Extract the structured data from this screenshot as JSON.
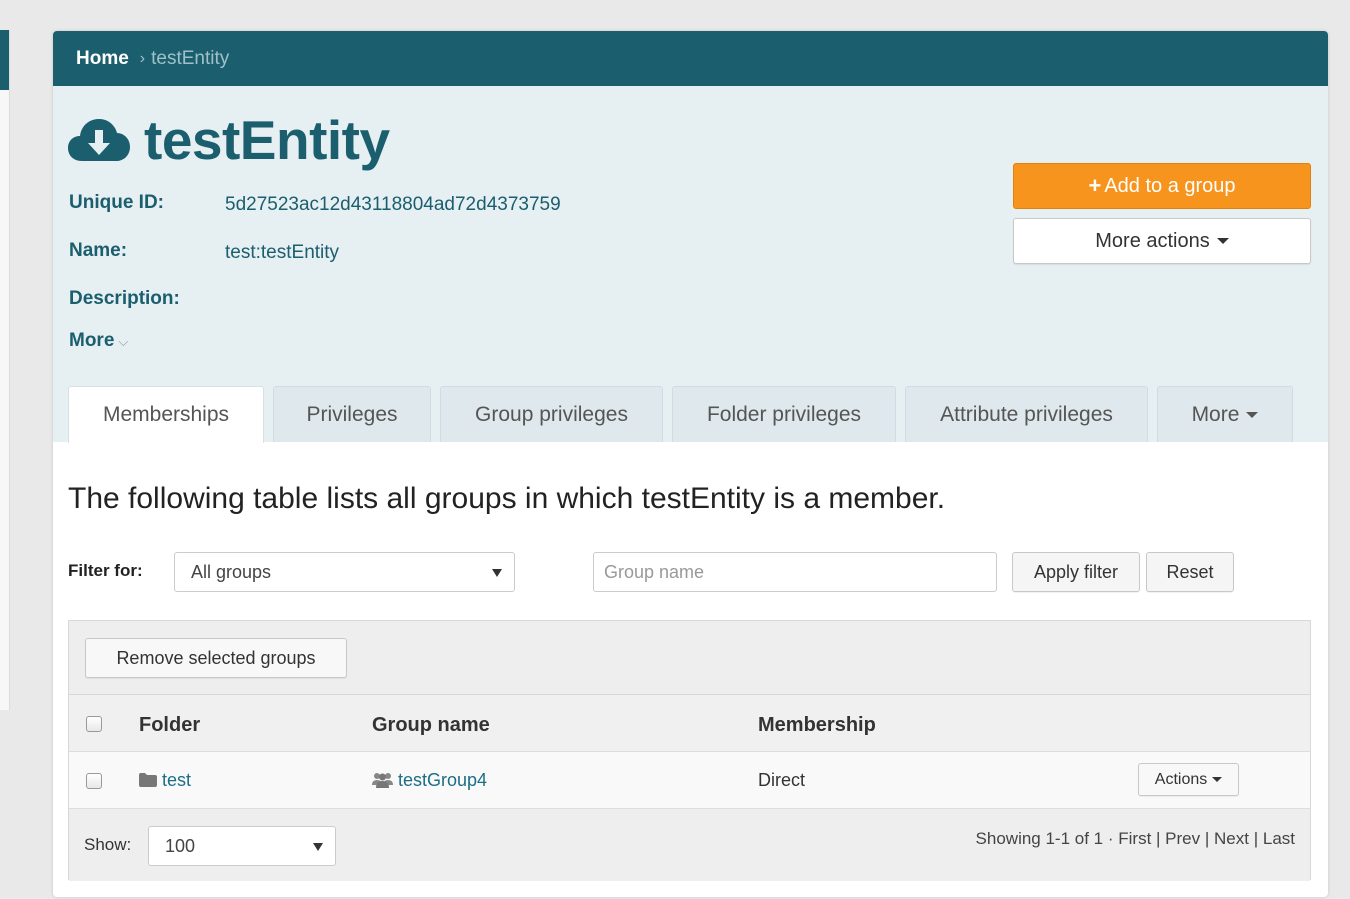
{
  "breadcrumb": {
    "home": "Home",
    "separator": "›",
    "current": "testEntity"
  },
  "entity": {
    "title": "testEntity",
    "icon": "cloud-download-icon",
    "unique_id_label": "Unique ID:",
    "unique_id": "5d27523ac12d43118804ad72d4373759",
    "name_label": "Name:",
    "name": "test:testEntity",
    "description_label": "Description:",
    "more_label": "More",
    "more_chevron": "⌵"
  },
  "actions": {
    "add_to_group": "Add to a group",
    "add_icon": "+",
    "more_actions": "More actions"
  },
  "tabs": [
    {
      "label": "Memberships",
      "active": true
    },
    {
      "label": "Privileges",
      "active": false
    },
    {
      "label": "Group privileges",
      "active": false
    },
    {
      "label": "Folder privileges",
      "active": false
    },
    {
      "label": "Attribute privileges",
      "active": false
    },
    {
      "label": "More",
      "active": false
    }
  ],
  "memberships": {
    "lead": "The following table lists all groups in which testEntity is a member.",
    "filter_label": "Filter for:",
    "filter_select": "All groups",
    "group_name_placeholder": "Group name",
    "apply_filter": "Apply filter",
    "reset": "Reset",
    "remove_selected": "Remove selected groups",
    "columns": {
      "folder": "Folder",
      "group_name": "Group name",
      "membership": "Membership"
    },
    "rows": [
      {
        "folder": "test",
        "group_name": "testGroup4",
        "membership": "Direct",
        "actions": "Actions"
      }
    ],
    "show_label": "Show:",
    "page_size": "100",
    "pager": {
      "showing": "Showing 1-1 of 1 · ",
      "first": "First",
      "prev": "Prev",
      "next": "Next",
      "last": "Last",
      "sep": " | "
    }
  },
  "colors": {
    "brand": "#1b5e6e",
    "accent": "#f7941d",
    "panel": "#e6eff2",
    "link": "#1b6e84"
  }
}
